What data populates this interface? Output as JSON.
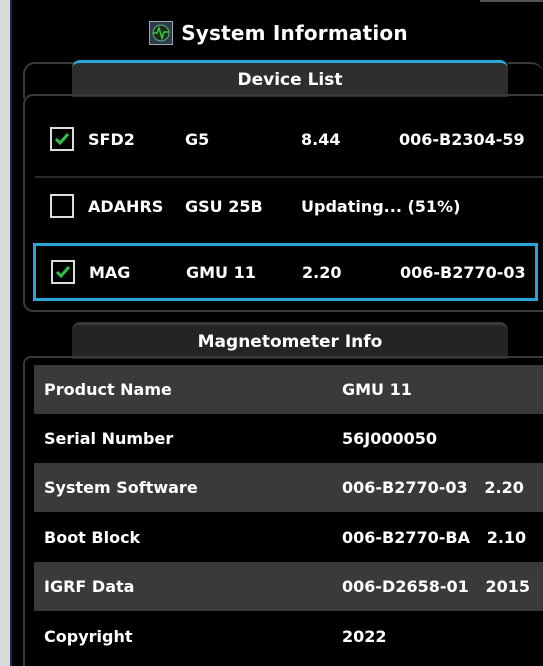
{
  "window": {
    "title": "System Information"
  },
  "device_list": {
    "tab_label": "Device List",
    "rows": [
      {
        "checked": true,
        "name": "SFD2",
        "model": "G5",
        "version": "8.44",
        "part": "006-B2304-59"
      },
      {
        "checked": false,
        "name": "ADAHRS",
        "model": "GSU 25B",
        "status": "Updating... (51%)",
        "progress_percent": 51
      },
      {
        "checked": true,
        "name": "MAG",
        "model": "GMU 11",
        "version": "2.20",
        "part": "006-B2770-03",
        "selected": true
      }
    ]
  },
  "magnetometer_info": {
    "tab_label": "Magnetometer Info",
    "rows": [
      {
        "label": "Product Name",
        "value": "GMU 11"
      },
      {
        "label": "Serial Number",
        "value": "56J000050"
      },
      {
        "label": "System Software",
        "value": "006-B2770-03   2.20"
      },
      {
        "label": "Boot Block",
        "value": "006-B2770-BA   2.10"
      },
      {
        "label": "IGRF Data",
        "value": "006-D2658-01   2015"
      },
      {
        "label": "Copyright",
        "value": "2022"
      }
    ]
  },
  "colors": {
    "accent": "#27a7d8",
    "row_shade": "#3a3a3a",
    "check": "#2ec24a"
  }
}
